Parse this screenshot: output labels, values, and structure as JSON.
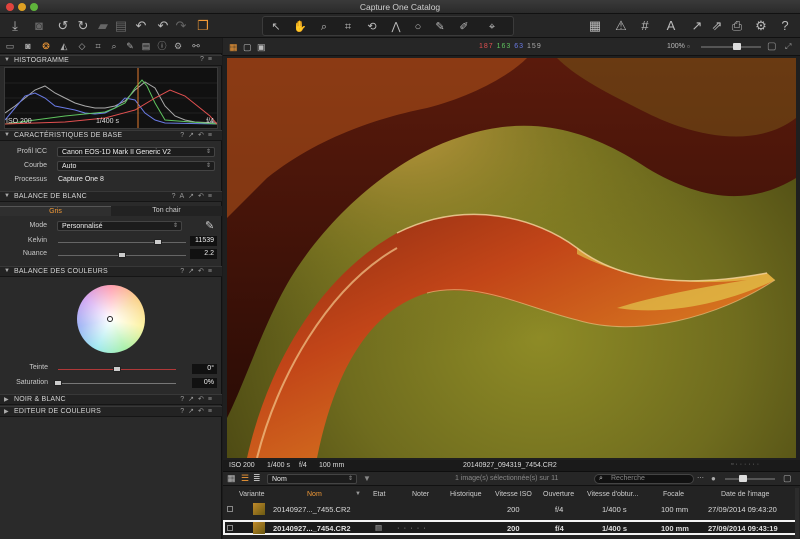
{
  "window": {
    "title": "Capture One Catalog"
  },
  "histogram": {
    "section_label": "HISTOGRAMME",
    "iso": "ISO 200",
    "shutter": "1/400 s",
    "aperture": "f/4"
  },
  "basic": {
    "section_label": "CARACTÉRISTIQUES DE BASE",
    "icc_label": "Profil ICC",
    "icc_value": "Canon EOS-1D Mark II Generic V2",
    "curve_label": "Courbe",
    "curve_value": "Auto",
    "process_label": "Processus",
    "process_value": "Capture One 8"
  },
  "white_balance": {
    "section_label": "BALANCE DE BLANC",
    "tab_gray": "Gris",
    "tab_skin": "Ton chair",
    "mode_label": "Mode",
    "mode_value": "Personnalisé",
    "kelvin_label": "Kelvin",
    "kelvin_value": "11539",
    "kelvin_level": 0.78,
    "tint_label": "Nuance",
    "tint_value": "2.2",
    "tint_level": 0.5
  },
  "color_balance": {
    "section_label": "BALANCE DES COULEURS",
    "hue_label": "Teinte",
    "hue_value": "0°",
    "hue_level": 0.5,
    "saturation_label": "Saturation",
    "saturation_value": "0%",
    "saturation_level": 0.0
  },
  "bw": {
    "section_label": "NOIR & BLANC"
  },
  "color_editor": {
    "section_label": "EDITEUR DE COULEURS"
  },
  "viewer": {
    "rgb": {
      "r": "187",
      "g": "163",
      "b": "63",
      "l": "159"
    },
    "zoom": "100%",
    "info_iso": "ISO 200",
    "info_shutter": "1/400 s",
    "info_aperture": "f/4",
    "info_focal": "100 mm",
    "info_filename": "20140927_094319_7454.CR2"
  },
  "browser": {
    "sort_value": "Nom",
    "selection_text": "1 image(s) sélectionnée(s) sur 11",
    "search_placeholder": "Recherche",
    "columns": {
      "variant": "Variante",
      "name": "Nom",
      "state": "Etat",
      "rating": "Noter",
      "history": "Historique",
      "iso": "Vitesse ISO",
      "aperture": "Ouverture",
      "shutter": "Vitesse d'obtur...",
      "focal": "Focale",
      "date": "Date de l'image"
    },
    "rows": [
      {
        "name": "20140927..._7455.CR2",
        "iso": "200",
        "aperture": "f/4",
        "shutter": "1/400 s",
        "focal": "100 mm",
        "date": "27/09/2014 09:43:20"
      },
      {
        "name": "20140927..._7454.CR2",
        "iso": "200",
        "aperture": "f/4",
        "shutter": "1/400 s",
        "focal": "100 mm",
        "date": "27/09/2014 09:43:19",
        "rating": "· · · · ·"
      }
    ]
  },
  "colors": {
    "accent": "#f29a37",
    "red": "#e25050",
    "green": "#5fc45f",
    "blue": "#6a7be6",
    "gray": "#aaaaaa"
  }
}
